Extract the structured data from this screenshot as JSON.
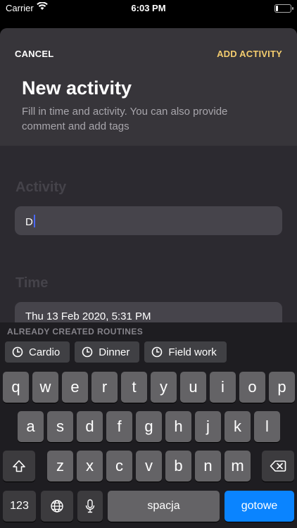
{
  "status_bar": {
    "carrier": "Carrier",
    "time": "6:03 PM"
  },
  "header": {
    "cancel_label": "CANCEL",
    "add_label": "ADD ACTIVITY",
    "title": "New activity",
    "subtitle": "Fill in time and activity. You can also provide comment and add tags"
  },
  "form": {
    "activity_label": "Activity",
    "activity_value": "D",
    "time_label": "Time",
    "time_value": "Thu 13 Feb 2020, 5:31 PM"
  },
  "suggestions": {
    "title": "ALREADY CREATED ROUTINES",
    "items": [
      "Cardio",
      "Dinner",
      "Field work"
    ]
  },
  "keyboard": {
    "row1": [
      "q",
      "w",
      "e",
      "r",
      "t",
      "y",
      "u",
      "i",
      "o",
      "p"
    ],
    "row2": [
      "a",
      "s",
      "d",
      "f",
      "g",
      "h",
      "j",
      "k",
      "l"
    ],
    "row3": [
      "z",
      "x",
      "c",
      "v",
      "b",
      "n",
      "m"
    ],
    "numbers_label": "123",
    "space_label": "spacja",
    "return_label": "gotowe"
  }
}
